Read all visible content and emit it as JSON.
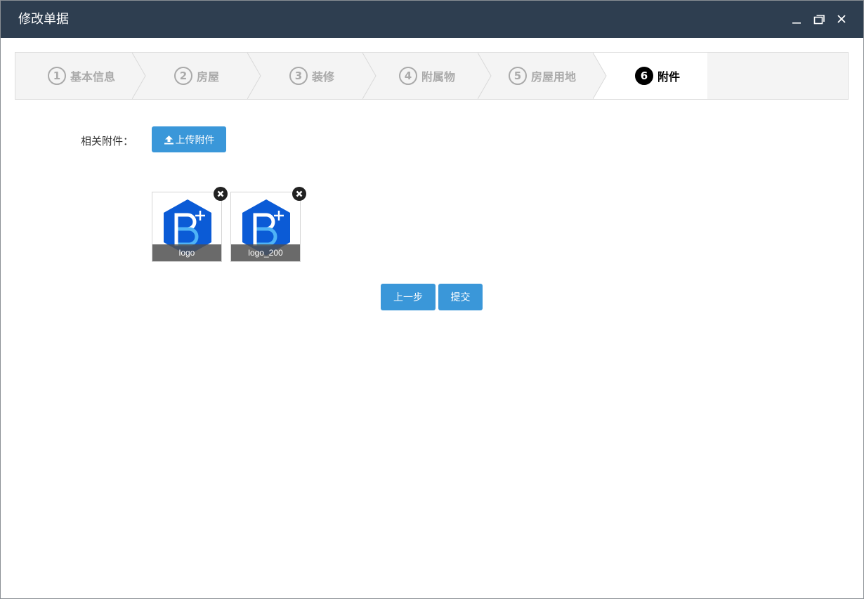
{
  "window": {
    "title": "修改单据"
  },
  "steps": [
    {
      "num": "1",
      "label": "基本信息"
    },
    {
      "num": "2",
      "label": "房屋"
    },
    {
      "num": "3",
      "label": "装修"
    },
    {
      "num": "4",
      "label": "附属物"
    },
    {
      "num": "5",
      "label": "房屋用地"
    },
    {
      "num": "6",
      "label": "附件"
    }
  ],
  "active_step": "6",
  "form": {
    "attachments_label": "相关附件：",
    "upload_button": "上传附件",
    "files": [
      {
        "name": "logo"
      },
      {
        "name": "logo_200"
      }
    ]
  },
  "actions": {
    "prev_label": "上一步",
    "submit_label": "提交"
  },
  "colors": {
    "titlebar": "#2e3e50",
    "primary_button": "#3a97d9",
    "logo_blue": "#0b5bd6",
    "logo_light": "#4fb3f6"
  },
  "icons": {
    "minimize": "minimize-icon",
    "maximize": "maximize-icon",
    "close": "close-icon",
    "upload": "upload-icon",
    "remove": "remove-circle-icon",
    "file_preview": "b-plus-logo"
  }
}
